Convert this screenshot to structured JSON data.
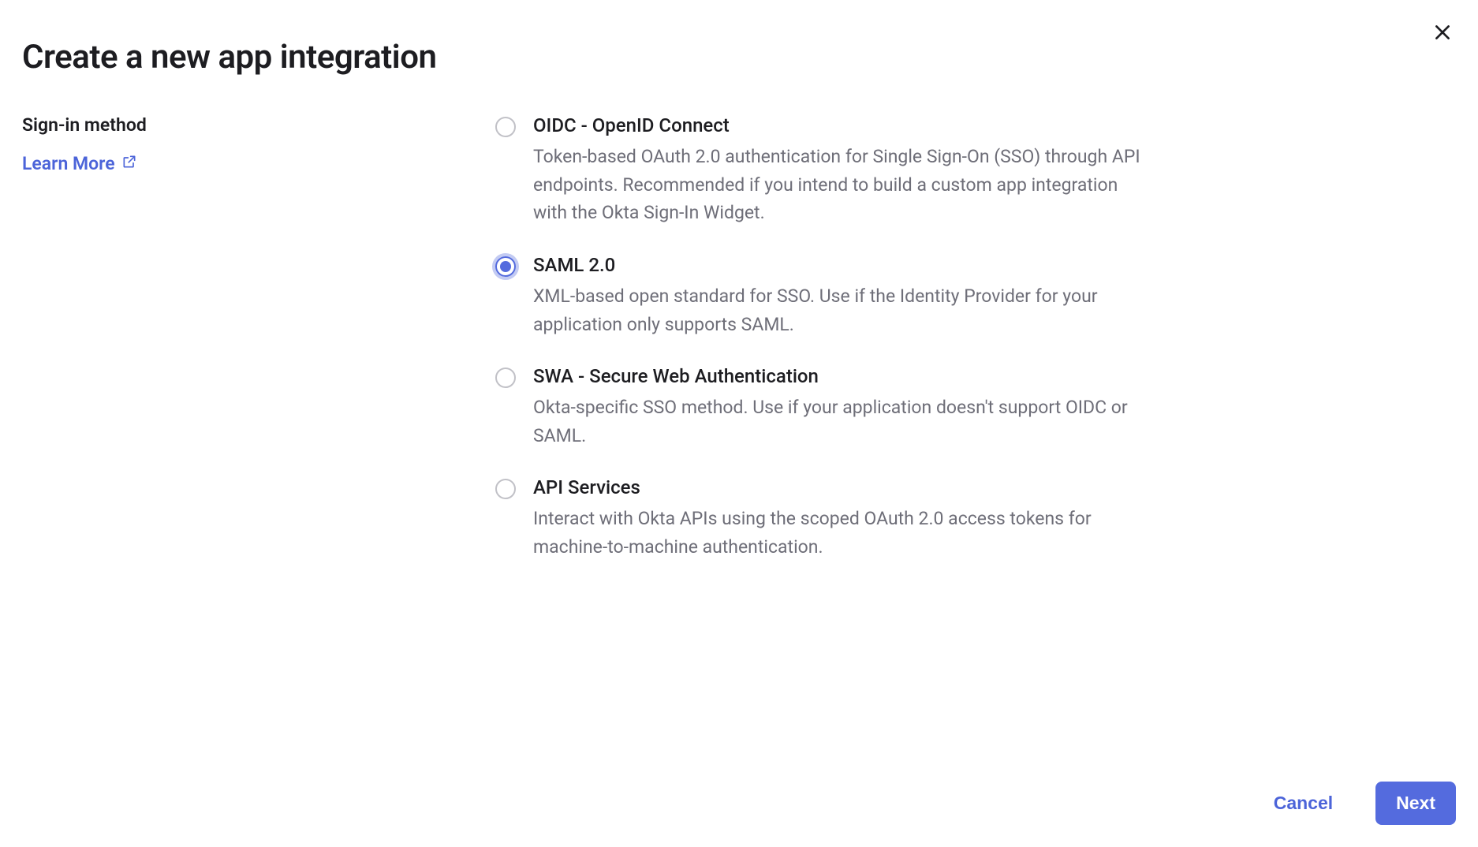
{
  "modal": {
    "title": "Create a new app integration",
    "section_label": "Sign-in method",
    "learn_more": "Learn More"
  },
  "options": [
    {
      "key": "oidc",
      "title": "OIDC - OpenID Connect",
      "description": "Token-based OAuth 2.0 authentication for Single Sign-On (SSO) through API endpoints. Recommended if you intend to build a custom app integration with the Okta Sign-In Widget.",
      "selected": false
    },
    {
      "key": "saml",
      "title": "SAML 2.0",
      "description": "XML-based open standard for SSO. Use if the Identity Provider for your application only supports SAML.",
      "selected": true
    },
    {
      "key": "swa",
      "title": "SWA - Secure Web Authentication",
      "description": "Okta-specific SSO method. Use if your application doesn't support OIDC or SAML.",
      "selected": false
    },
    {
      "key": "api",
      "title": "API Services",
      "description": "Interact with Okta APIs using the scoped OAuth 2.0 access tokens for machine-to-machine authentication.",
      "selected": false
    }
  ],
  "footer": {
    "cancel": "Cancel",
    "next": "Next"
  }
}
